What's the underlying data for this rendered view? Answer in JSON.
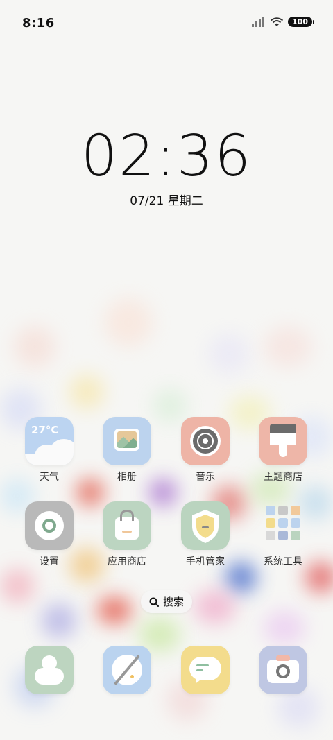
{
  "status_bar": {
    "time": "8:16",
    "battery": "100"
  },
  "lock_clock": {
    "time": "02:36",
    "date": "07/21 星期二"
  },
  "apps_row1": [
    {
      "label": "天气",
      "icon": "weather-icon",
      "temp": "27°C",
      "color": "#b9d2f0"
    },
    {
      "label": "相册",
      "icon": "gallery-icon",
      "color": "#bcd3ee"
    },
    {
      "label": "音乐",
      "icon": "music-icon",
      "color": "#eeb4a6"
    },
    {
      "label": "主题商店",
      "icon": "theme-store-icon",
      "color": "#eeb6a8"
    }
  ],
  "apps_row2": [
    {
      "label": "设置",
      "icon": "settings-icon",
      "color": "#b9b9b9"
    },
    {
      "label": "应用商店",
      "icon": "app-store-icon",
      "color": "#bcd5c1"
    },
    {
      "label": "手机管家",
      "icon": "security-icon",
      "color": "#bad4bf"
    },
    {
      "label": "系统工具",
      "icon": "folder-icon",
      "color": "#eeeeee"
    }
  ],
  "search": {
    "label": "搜索"
  },
  "dock": [
    {
      "icon": "contacts-icon",
      "color": "#bdd5c0"
    },
    {
      "icon": "browser-icon",
      "color": "#bad3ef"
    },
    {
      "icon": "messages-icon",
      "color": "#f3dc8c"
    },
    {
      "icon": "camera-icon",
      "color": "#bfc7e3"
    }
  ]
}
